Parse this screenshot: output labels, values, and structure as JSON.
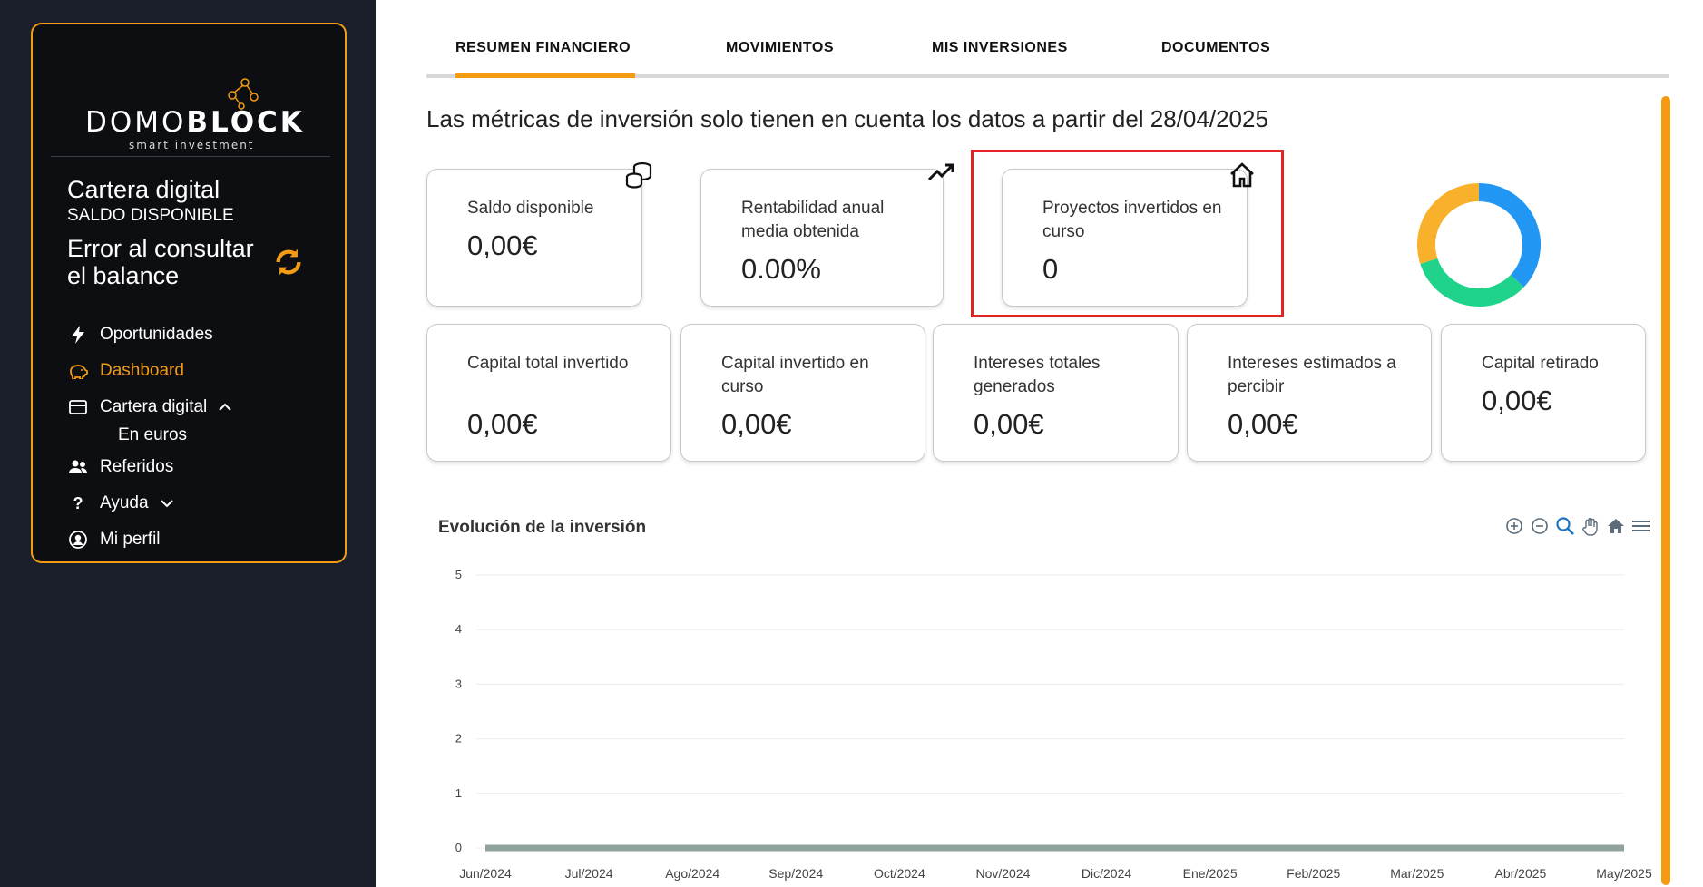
{
  "brand": {
    "name_light": "DOMO",
    "name_bold": "BLOCK",
    "tagline": "smart investment",
    "accent": "#f39c12"
  },
  "sidebar": {
    "wallet_title": "Cartera digital",
    "wallet_subtitle": "SALDO DISPONIBLE",
    "wallet_error": "Error al consultar el balance",
    "items": [
      {
        "label": "Oportunidades",
        "icon": "bolt-icon"
      },
      {
        "label": "Dashboard",
        "icon": "piggy-bank-icon",
        "active": true
      },
      {
        "label": "Cartera digital",
        "icon": "credit-card-icon",
        "sub": "En euros"
      },
      {
        "label": "Referidos",
        "icon": "users-icon"
      },
      {
        "label": "Ayuda",
        "icon": "question-icon"
      },
      {
        "label": "Mi perfil",
        "icon": "user-circle-icon"
      }
    ]
  },
  "tabs": [
    "RESUMEN FINANCIERO",
    "MOVIMIENTOS",
    "MIS INVERSIONES",
    "DOCUMENTOS"
  ],
  "notice": "Las métricas de inversión solo tienen en cuenta los datos a partir del 28/04/2025",
  "metrics_top": [
    {
      "label": "Saldo disponible",
      "value": "0,00€",
      "icon": "coins-icon"
    },
    {
      "label": "Rentabilidad anual media obtenida",
      "value": "0.00%",
      "icon": "trending-up-icon"
    },
    {
      "label": "Proyectos invertidos en curso",
      "value": "0",
      "icon": "home-icon"
    }
  ],
  "metrics_bottom": [
    {
      "label": "Capital total invertido",
      "value": "0,00€"
    },
    {
      "label": "Capital invertido en curso",
      "value": "0,00€"
    },
    {
      "label": "Intereses totales generados",
      "value": "0,00€"
    },
    {
      "label": "Intereses estimados a percibir",
      "value": "0,00€"
    },
    {
      "label": "Capital retirado",
      "value": "0,00€"
    }
  ],
  "donut": {
    "segments": [
      {
        "fraction": 0.37,
        "color": "#2196f3"
      },
      {
        "fraction": 0.33,
        "color": "#1fd38b"
      },
      {
        "fraction": 0.3,
        "color": "#f9b12b"
      }
    ]
  },
  "chart_tools": [
    "zoom-in-icon",
    "zoom-out-icon",
    "magnifier-icon",
    "pan-hand-icon",
    "reset-home-icon",
    "menu-icon"
  ],
  "chart_data": {
    "type": "area",
    "title": "Evolución de la inversión",
    "categories": [
      "Jun/2024",
      "Jul/2024",
      "Ago/2024",
      "Sep/2024",
      "Oct/2024",
      "Nov/2024",
      "Dic/2024",
      "Ene/2025",
      "Feb/2025",
      "Mar/2025",
      "Abr/2025",
      "May/2025"
    ],
    "yticks": [
      "5",
      "4",
      "3",
      "2",
      "1",
      "0"
    ],
    "ylim": [
      0,
      5
    ],
    "series": [
      {
        "values": [
          0,
          0,
          0,
          0,
          0,
          0,
          0,
          0,
          0,
          0,
          0,
          0
        ],
        "color": "#8fa39a"
      }
    ],
    "grid": true
  }
}
